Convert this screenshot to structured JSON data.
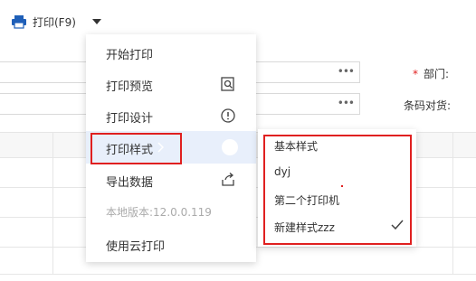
{
  "toolbar": {
    "print_label": "打印(F9)"
  },
  "form": {
    "department_label": "部门:",
    "required_mark": "*",
    "barcode_label": "条码对货:",
    "more_icon_text": "•••"
  },
  "menu": {
    "items": [
      {
        "label": "开始打印"
      },
      {
        "label": "打印预览",
        "icon": "preview-icon"
      },
      {
        "label": "打印设计",
        "icon": "info-circle-icon"
      },
      {
        "label": "打印样式",
        "icon": "toggle-icon",
        "active": true
      },
      {
        "label": "导出数据",
        "icon": "share-icon"
      },
      {
        "label": "本地版本:12.0.0.119",
        "disabled": true
      },
      {
        "label": "使用云打印"
      }
    ]
  },
  "submenu": {
    "items": [
      {
        "label": "基本样式"
      },
      {
        "label": "dyj"
      },
      {
        "label": "第二个打印机"
      },
      {
        "label": "新建样式zzz",
        "checked": true
      }
    ]
  },
  "colors": {
    "accent": "#1f5fb8",
    "highlight": "#e02020",
    "active_bg": "#e8effb"
  }
}
